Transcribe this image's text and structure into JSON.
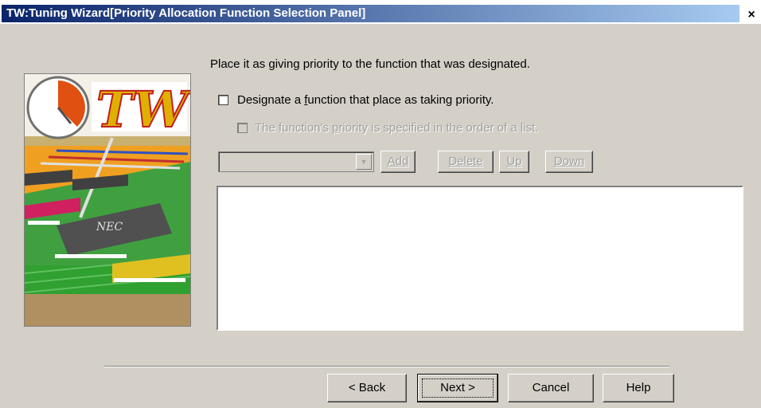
{
  "window": {
    "title": "TW:Tuning Wizard[Priority Allocation Function Selection Panel]",
    "close_glyph": "×"
  },
  "panel": {
    "instruction": "Place it as giving priority to the function that was designated.",
    "designate_checkbox": {
      "label_before": "Designate a ",
      "label_accel": "f",
      "label_after": "unction that place as taking priority.",
      "checked": false
    },
    "order_checkbox": {
      "label_before": "The function's ",
      "label_accel": "p",
      "label_after": "riority is specified in the order of a list.",
      "checked": false,
      "enabled": false
    },
    "function_select": {
      "value": "",
      "enabled": false
    },
    "list_buttons": {
      "add": "Add",
      "delete": "Delete",
      "up": "Up",
      "down": "Down"
    },
    "function_list": []
  },
  "graphic": {
    "logo_text": "TW",
    "chip_label": "NEC"
  },
  "footer": {
    "back_label": "< Back",
    "next_label": "Next >",
    "cancel_label": "Cancel",
    "help_label": "Help"
  }
}
